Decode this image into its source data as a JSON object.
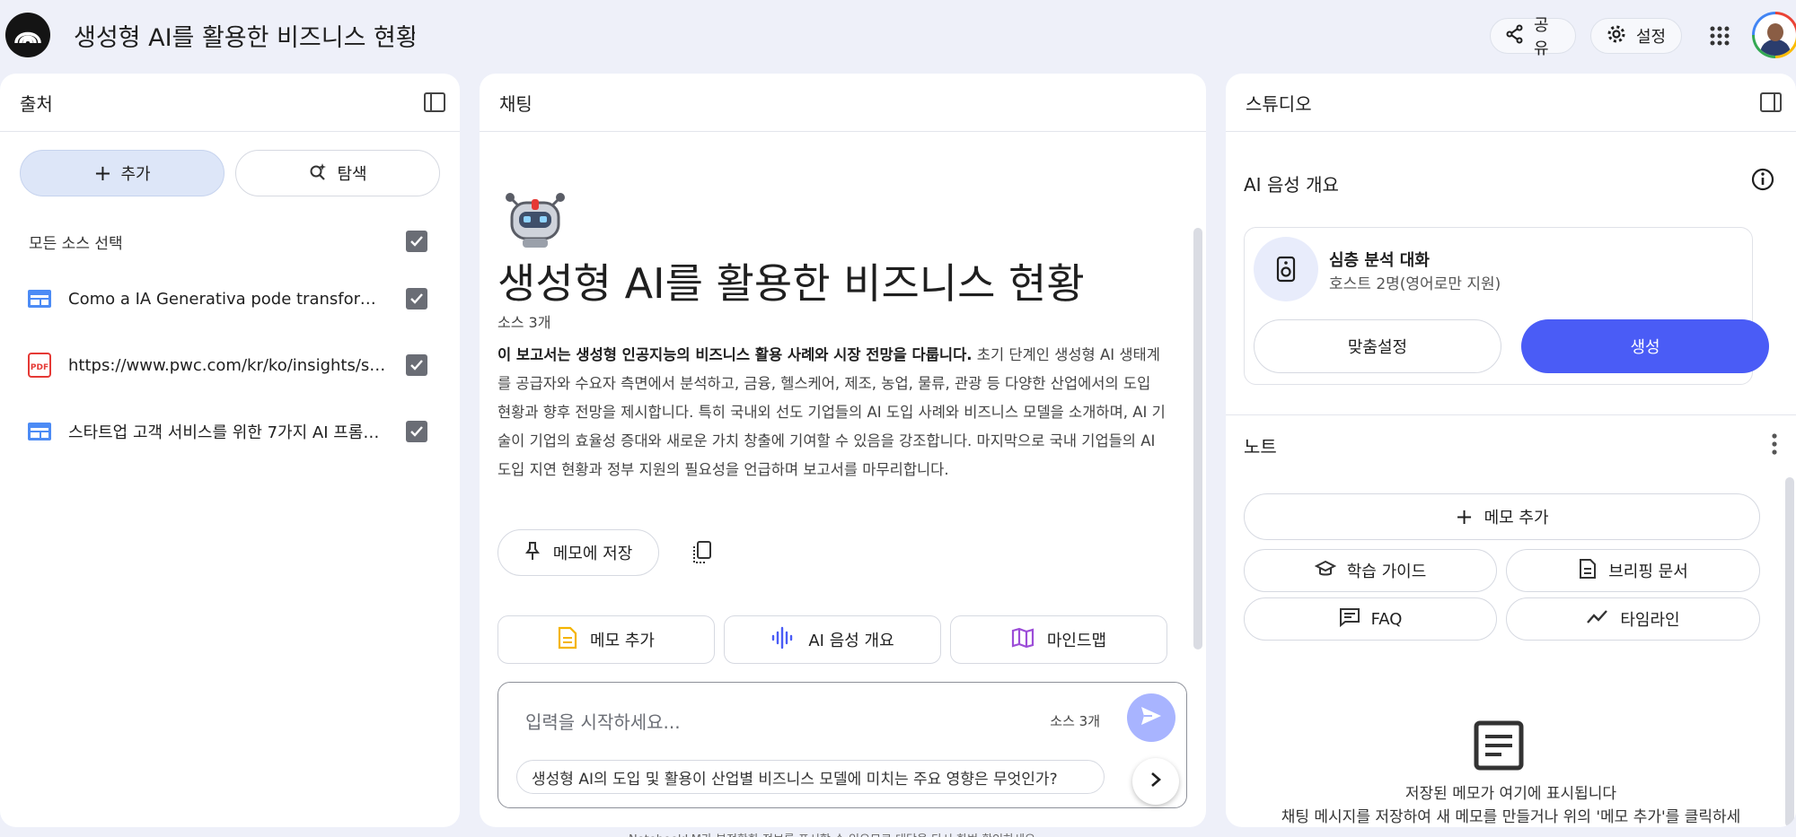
{
  "app": {
    "title": "생성형 AI를 활용한 비즈니스 현황"
  },
  "header": {
    "share_label": "공유",
    "settings_label": "설정"
  },
  "sources": {
    "title": "출처",
    "add_label": "추가",
    "explore_label": "탐색",
    "select_all_label": "모든 소스 선택",
    "items": [
      {
        "label": "Como a IA Generativa pode transformar ...",
        "type": "web"
      },
      {
        "label": "https://www.pwc.com/kr/ko/insights/samil...",
        "type": "pdf"
      },
      {
        "label": "스타트업 고객 서비스를 위한 7가지 AI 프롬프...",
        "type": "web"
      }
    ]
  },
  "chat": {
    "title": "채팅",
    "notebook_title": "생성형 AI를 활용한 비즈니스 현황",
    "source_count": "소스 3개",
    "summary_bold": "이 보고서는 생성형 인공지능의 비즈니스 활용 사례와 시장 전망을 다룹니다.",
    "summary_rest": " 초기 단계인 생성형 AI 생태계를 공급자와 수요자 측면에서 분석하고, 금융, 헬스케어, 제조, 농업, 물류, 관광 등 다양한 산업에서의 도입 현황과 향후 전망을 제시합니다. 특히 국내외 선도 기업들의 AI 도입 사례와 비즈니스 모델을 소개하며, AI 기술이 기업의 효율성 증대와 새로운 가치 창출에 기여할 수 있음을 강조합니다. 마지막으로 국내 기업들의 AI 도입 지연 현황과 정부 지원의 필요성을 언급하며 보고서를 마무리합니다.",
    "save_memo_label": "메모에 저장",
    "actions": [
      {
        "label": "메모 추가",
        "color": "#f4b400"
      },
      {
        "label": "AI 음성 개요",
        "color": "#4a5cf6"
      },
      {
        "label": "마인드맵",
        "color": "#9c4dd8"
      }
    ],
    "input_placeholder": "입력을 시작하세요...",
    "input_source_count": "소스 3개",
    "suggestion": "생성형 AI의 도입 및 활용이 산업별 비즈니스 모델에 미치는 주요 영향은 무엇인가?",
    "footnote": "NotebookLM가 부정확한 정보를 표시할 수 있으므로 대답을 다시 한번 확인하세요."
  },
  "studio": {
    "title": "스튜디오",
    "audio_overview_label": "AI 음성 개요",
    "deep_dive_title": "심층 분석 대화",
    "deep_dive_sub": "호스트 2명(영어로만 지원)",
    "customize_label": "맞춤설정",
    "generate_label": "생성",
    "notes_title": "노트",
    "add_memo_label": "메모 추가",
    "study_guide_label": "학습 가이드",
    "briefing_label": "브리핑 문서",
    "faq_label": "FAQ",
    "timeline_label": "타임라인",
    "empty_title": "저장된 메모가 여기에 표시됩니다",
    "empty_sub": "채팅 메시지를 저장하여 새 메모를 만들거나 위의 '메모 추가'를 클릭하세"
  },
  "colors": {
    "accent": "#4a5cf6",
    "send_disabled": "#a8b4ff",
    "checkbox": "#6a6d75",
    "bg": "#eef0f9"
  }
}
